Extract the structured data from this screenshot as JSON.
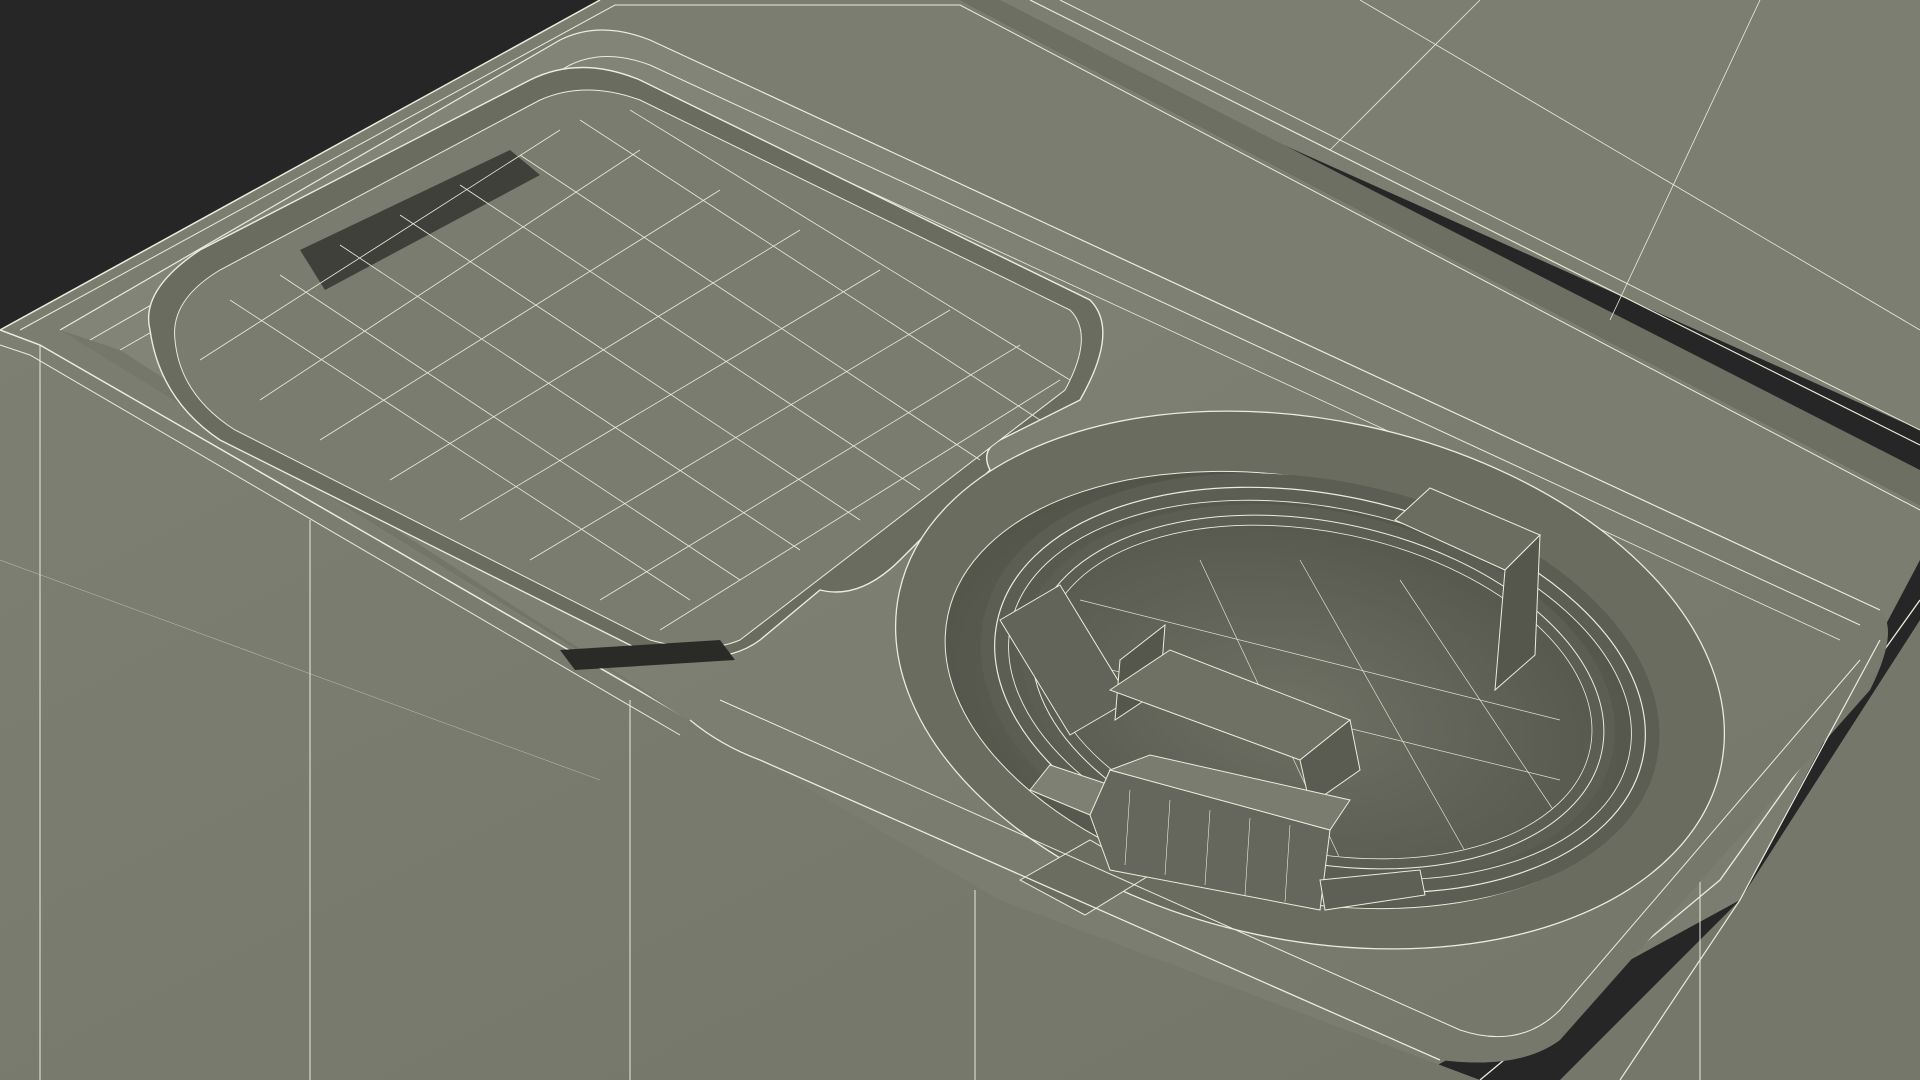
{
  "scene": {
    "subject": "phone-packaging-box-wireframe",
    "render_style": "wireframe-over-clay",
    "colors": {
      "background": "#262626",
      "surface": "#7b7d70",
      "surface_light": "#8a8c7f",
      "surface_shadow": "#5f6156",
      "recess": "#54564c",
      "wire": "#ecebdc",
      "edge_dark": "#1e1f1b"
    }
  }
}
